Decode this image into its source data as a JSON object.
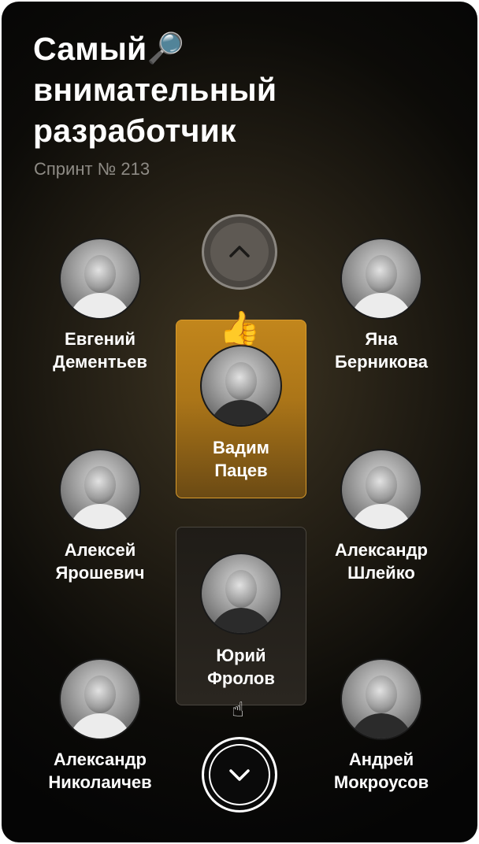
{
  "header": {
    "title_line1": "Самый",
    "title_emoji": "🔎",
    "title_line2": "внимательный",
    "title_line3": "разработчик",
    "subtitle": "Спринт № 213"
  },
  "people": [
    {
      "first": "Евгений",
      "last": "Дементьев"
    },
    {
      "first": "Яна",
      "last": "Берникова"
    },
    {
      "first": "Вадим",
      "last": "Пацев"
    },
    {
      "first": "Алексей",
      "last": "Ярошевич"
    },
    {
      "first": "Александр",
      "last": "Шлейко"
    },
    {
      "first": "Юрий",
      "last": "Фролов"
    },
    {
      "first": "Александр",
      "last": "Николаичев"
    },
    {
      "first": "Андрей",
      "last": "Мокроусов"
    }
  ],
  "leader_emoji": "👍",
  "cursor_glyph": "☝",
  "icons": {
    "up": "chevron-up-icon",
    "down": "chevron-down-icon"
  },
  "colors": {
    "leader_gold": "#c2861c",
    "background": "#0c0b08",
    "text": "#ffffff",
    "subtitle": "#8e8b85"
  }
}
